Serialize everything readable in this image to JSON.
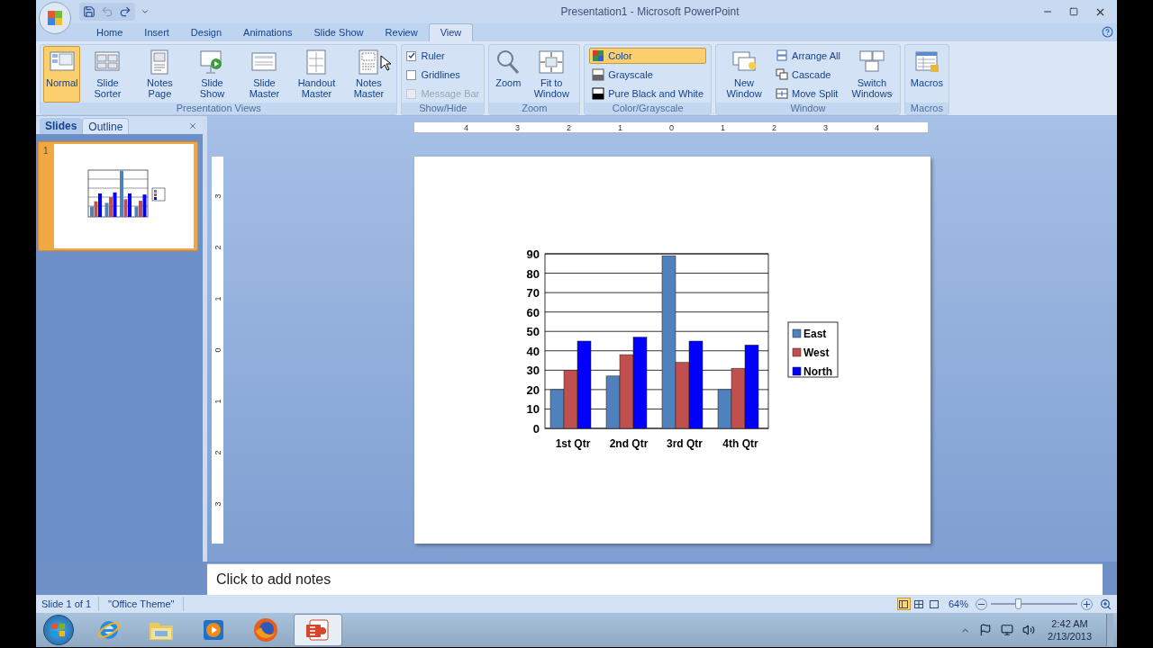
{
  "window": {
    "title": "Presentation1 - Microsoft PowerPoint"
  },
  "ribbon_tabs": [
    {
      "label": "Home",
      "selected": false
    },
    {
      "label": "Insert",
      "selected": false
    },
    {
      "label": "Design",
      "selected": false
    },
    {
      "label": "Animations",
      "selected": false
    },
    {
      "label": "Slide Show",
      "selected": false
    },
    {
      "label": "Review",
      "selected": false
    },
    {
      "label": "View",
      "selected": true
    }
  ],
  "ribbon_groups": [
    {
      "label": "Presentation Views",
      "items": [
        {
          "kind": "large",
          "label": "Normal",
          "selected": true
        },
        {
          "kind": "large",
          "label": "Slide Sorter",
          "selected": false
        },
        {
          "kind": "large",
          "label": "Notes Page",
          "selected": false
        },
        {
          "kind": "large",
          "label": "Slide Show",
          "selected": false
        },
        {
          "kind": "large",
          "label": "Slide Master",
          "selected": false
        },
        {
          "kind": "large",
          "label": "Handout Master",
          "selected": false
        },
        {
          "kind": "large",
          "label": "Notes Master",
          "selected": false
        }
      ]
    },
    {
      "label": "Show/Hide",
      "items": [
        {
          "kind": "checkbox",
          "label": "Ruler",
          "checked": true,
          "disabled": false
        },
        {
          "kind": "checkbox",
          "label": "Gridlines",
          "checked": false,
          "disabled": false
        },
        {
          "kind": "checkbox",
          "label": "Message Bar",
          "checked": false,
          "disabled": true
        }
      ]
    },
    {
      "label": "Zoom",
      "items": [
        {
          "kind": "large",
          "label": "Zoom",
          "selected": false
        },
        {
          "kind": "large",
          "label": "Fit to Window",
          "selected": false
        }
      ]
    },
    {
      "label": "Color/Grayscale",
      "items": [
        {
          "kind": "small",
          "label": "Color",
          "selected": true
        },
        {
          "kind": "small",
          "label": "Grayscale",
          "selected": false
        },
        {
          "kind": "small",
          "label": "Pure Black and White",
          "selected": false
        }
      ]
    },
    {
      "label": "Window",
      "items": [
        {
          "kind": "large",
          "label": "New Window",
          "selected": false
        },
        {
          "kind": "small",
          "label": "Arrange All",
          "selected": false
        },
        {
          "kind": "small",
          "label": "Cascade",
          "selected": false
        },
        {
          "kind": "small",
          "label": "Move Split",
          "selected": false
        },
        {
          "kind": "dropdown",
          "label": "Switch Windows",
          "selected": false
        }
      ]
    },
    {
      "label": "Macros",
      "items": [
        {
          "kind": "large",
          "label": "Macros",
          "selected": false
        }
      ]
    }
  ],
  "slides_pane": {
    "tabs": [
      {
        "label": "Slides",
        "selected": true
      },
      {
        "label": "Outline",
        "selected": false
      }
    ],
    "slides": [
      {
        "number": "1",
        "selected": true
      }
    ]
  },
  "rulers": {
    "horizontal": [
      "4",
      "3",
      "2",
      "1",
      "0",
      "1",
      "2",
      "3",
      "4"
    ],
    "vertical": [
      "3",
      "2",
      "1",
      "0",
      "1",
      "2",
      "3"
    ]
  },
  "slide": {
    "chart_data": {
      "type": "bar",
      "orientation": "vertical",
      "categories": [
        "1st Qtr",
        "2nd Qtr",
        "3rd Qtr",
        "4th Qtr"
      ],
      "series": [
        {
          "name": "East",
          "color": "#4f81bd",
          "values": [
            20,
            27,
            89,
            20
          ]
        },
        {
          "name": "West",
          "color": "#c0504d",
          "values": [
            30,
            38,
            34,
            31
          ]
        },
        {
          "name": "North",
          "color": "#0000ff",
          "values": [
            45,
            47,
            45,
            43
          ]
        }
      ],
      "ylim": [
        0,
        90
      ],
      "grid": true,
      "legend": true,
      "yticks": [
        0,
        10,
        20,
        30,
        40,
        50,
        60,
        70,
        80,
        90
      ]
    }
  },
  "notes": {
    "placeholder": "Click to add notes"
  },
  "status_bar": {
    "slide_info": "Slide 1 of 1",
    "theme": "\"Office Theme\"",
    "views": [
      {
        "selected": true
      },
      {
        "selected": false
      },
      {
        "selected": false
      }
    ],
    "zoom": {
      "label": "64%",
      "level": 0.3
    }
  },
  "taskbar": {
    "apps": [
      {
        "kind": "browser",
        "selected": false
      },
      {
        "kind": "folder",
        "selected": false
      },
      {
        "kind": "media",
        "selected": false
      },
      {
        "kind": "firefox",
        "selected": false
      },
      {
        "kind": "powerpoint",
        "selected": true
      }
    ],
    "time": "2:42 AM",
    "date": "2/13/2013"
  }
}
